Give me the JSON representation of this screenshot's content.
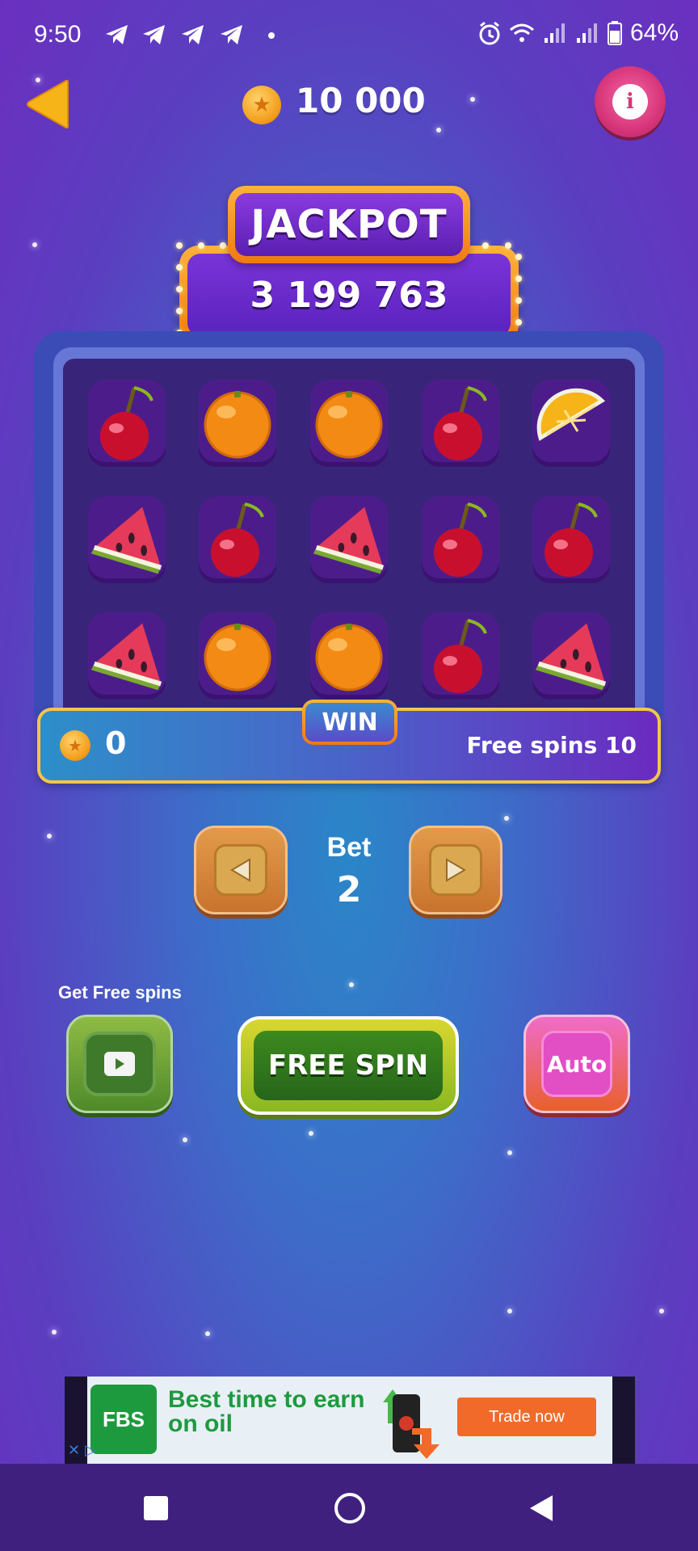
{
  "status_bar": {
    "time": "9:50",
    "battery": "64%",
    "icons": [
      "telegram-icon",
      "telegram-icon",
      "telegram-icon",
      "telegram-icon",
      "dot-icon",
      "alarm-icon",
      "wifi-icon",
      "signal-icon",
      "signal-icon",
      "battery-icon"
    ]
  },
  "header": {
    "balance": "10 000",
    "back_icon": "back-arrow-icon",
    "info_icon": "info-icon"
  },
  "jackpot": {
    "title": "JACKPOT",
    "amount": "3 199 763"
  },
  "reels": [
    [
      "cherry",
      "orange",
      "orange",
      "cherry",
      "orange-slice"
    ],
    [
      "watermelon",
      "cherry",
      "watermelon",
      "cherry",
      "cherry"
    ],
    [
      "watermelon",
      "orange",
      "orange",
      "cherry",
      "watermelon"
    ]
  ],
  "win_bar": {
    "label": "WIN",
    "value": "0",
    "free_spins": "Free spins 10"
  },
  "bet": {
    "label": "Bet",
    "value": "2"
  },
  "actions": {
    "get_free_label": "Get Free spins",
    "spin_label": "FREE SPIN",
    "auto_label": "Auto"
  },
  "ad": {
    "brand": "FBS",
    "headline": "Best time to earn on oil",
    "cta": "Trade now"
  },
  "colors": {
    "accent_orange": "#f07a12",
    "jackpot_purple": "#5a22bd",
    "spin_green": "#27661a",
    "auto_pink": "#e24ec4",
    "info_pink": "#d8357a"
  }
}
